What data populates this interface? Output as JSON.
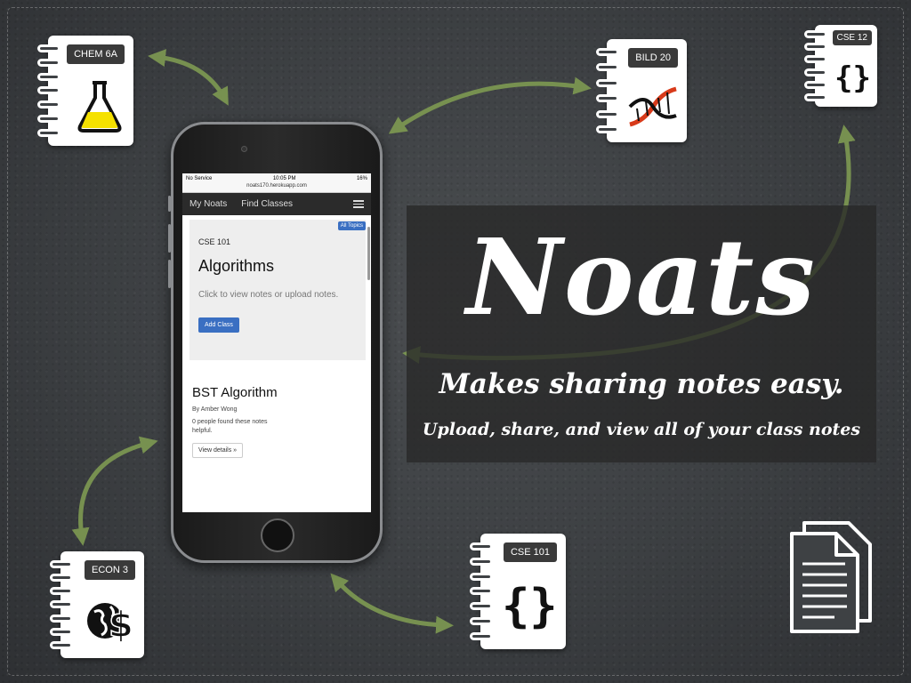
{
  "notebooks": [
    {
      "id": "chem",
      "label": "CHEM 6A",
      "icon": "flask-icon"
    },
    {
      "id": "bild",
      "label": "BILD 20",
      "icon": "dna-icon"
    },
    {
      "id": "cse12",
      "label": "CSE 12",
      "icon": "braces-icon"
    },
    {
      "id": "econ",
      "label": "ECON 3",
      "icon": "globe-dollar-icon"
    },
    {
      "id": "cse101",
      "label": "CSE 101",
      "icon": "braces-icon"
    }
  ],
  "banner": {
    "brand": "Noats",
    "tagline": "Makes sharing notes easy.",
    "subtagline": "Upload, share, and view all of your class notes"
  },
  "phone": {
    "status": {
      "carrier": "No Service",
      "time": "10:05 PM",
      "battery": "16%"
    },
    "url": "noats170.herokuapp.com",
    "nav": {
      "my_noats": "My Noats",
      "find_classes": "Find Classes"
    },
    "jumbotron": {
      "badge": "All Topics",
      "course_code": "CSE 101",
      "course_title": "Algorithms",
      "description": "Click to view notes or upload notes.",
      "add_button": "Add Class"
    },
    "note": {
      "title": "BST Algorithm",
      "author": "By Amber Wong",
      "helpful": "0 people found these notes helpful.",
      "details_button": "View details »"
    }
  },
  "colors": {
    "arrow": "#7e9a52",
    "flask": "#f5e100",
    "dna_red": "#d83a1a",
    "primary_button": "#3a6fc2"
  }
}
